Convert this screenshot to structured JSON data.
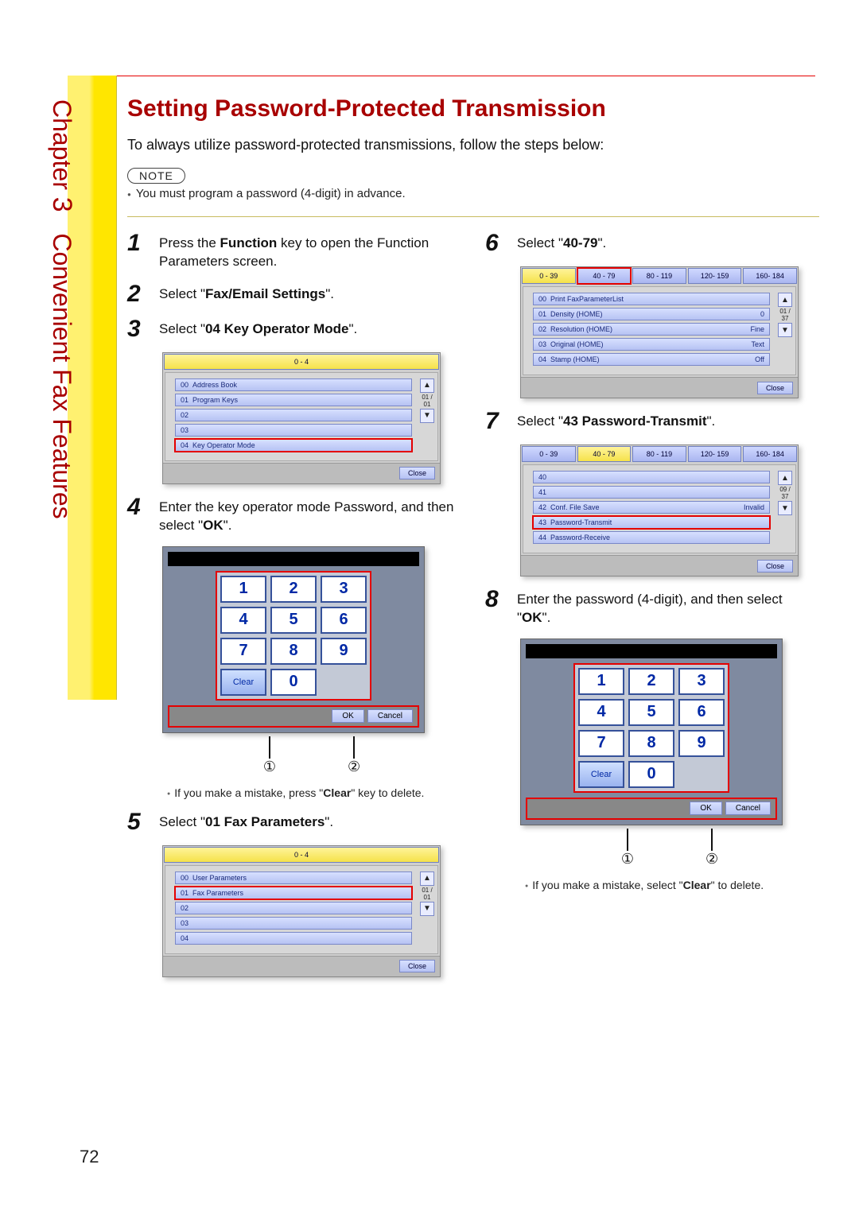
{
  "chapter": {
    "label": "Chapter",
    "number": "3",
    "subtitle": "Convenient Fax Features"
  },
  "page_number": "72",
  "title": "Setting Password-Protected Transmission",
  "intro": "To always utilize password-protected transmissions, follow the steps below:",
  "note": {
    "pill": "NOTE",
    "text": "You must program a password (4-digit) in advance."
  },
  "steps": {
    "s1": {
      "n": "1",
      "pre": "Press the ",
      "b": "Function",
      "post": " key to open the Function Parameters screen."
    },
    "s2": {
      "n": "2",
      "pre": "Select \"",
      "b": "Fax/Email Settings",
      "post": "\"."
    },
    "s3": {
      "n": "3",
      "pre": "Select \"",
      "b": "04 Key Operator Mode",
      "post": "\"."
    },
    "s4": {
      "n": "4",
      "pre": "Enter the key operator mode Password, and then select \"",
      "b": "OK",
      "post": "\"."
    },
    "s4_sub": {
      "pre": "If you make a mistake, press \"",
      "b": "Clear",
      "post": "\" key to delete."
    },
    "s5": {
      "n": "5",
      "pre": "Select \"",
      "b": "01 Fax Parameters",
      "post": "\"."
    },
    "s6": {
      "n": "6",
      "pre": "Select \"",
      "b": "40-79",
      "post": "\"."
    },
    "s7": {
      "n": "7",
      "pre": "Select \"",
      "b": "43 Password-Transmit",
      "post": "\"."
    },
    "s8": {
      "n": "8",
      "pre": "Enter the password (4-digit), and then select \"",
      "b": "OK",
      "post": "\"."
    },
    "s8_sub": {
      "pre": "If you make a mistake, select \"",
      "b": "Clear",
      "post": "\" to delete."
    }
  },
  "callout": {
    "c1": "①",
    "c2": "②"
  },
  "keypad": {
    "keys": [
      "1",
      "2",
      "3",
      "4",
      "5",
      "6",
      "7",
      "8",
      "9"
    ],
    "clear": "Clear",
    "zero": "0",
    "ok": "OK",
    "cancel": "Cancel"
  },
  "panel3": {
    "tab": "0 - 4",
    "rows": [
      {
        "id": "00",
        "label": "Address Book"
      },
      {
        "id": "01",
        "label": "Program Keys"
      },
      {
        "id": "02",
        "label": ""
      },
      {
        "id": "03",
        "label": ""
      },
      {
        "id": "04",
        "label": "Key Operator Mode"
      }
    ],
    "scroll": "01 / 01",
    "close": "Close"
  },
  "panel5": {
    "tab": "0 - 4",
    "rows": [
      {
        "id": "00",
        "label": "User Parameters"
      },
      {
        "id": "01",
        "label": "Fax Parameters"
      },
      {
        "id": "02",
        "label": ""
      },
      {
        "id": "03",
        "label": ""
      },
      {
        "id": "04",
        "label": ""
      }
    ],
    "scroll": "01 / 01",
    "close": "Close"
  },
  "panel6": {
    "tabs": [
      "0 - 39",
      "40 - 79",
      "80 - 119",
      "120- 159",
      "160- 184"
    ],
    "active_tab": 1,
    "rows": [
      {
        "id": "00",
        "label": "Print FaxParameterList",
        "val": ""
      },
      {
        "id": "01",
        "label": "Density (HOME)",
        "val": "0"
      },
      {
        "id": "02",
        "label": "Resolution (HOME)",
        "val": "Fine"
      },
      {
        "id": "03",
        "label": "Original (HOME)",
        "val": "Text"
      },
      {
        "id": "04",
        "label": "Stamp (HOME)",
        "val": "Off"
      }
    ],
    "scroll": "01 / 37",
    "close": "Close"
  },
  "panel7": {
    "tabs": [
      "0 - 39",
      "40 - 79",
      "80 - 119",
      "120- 159",
      "160- 184"
    ],
    "active_tab": 1,
    "rows": [
      {
        "id": "40",
        "label": "",
        "val": ""
      },
      {
        "id": "41",
        "label": "",
        "val": ""
      },
      {
        "id": "42",
        "label": "Conf. File Save",
        "val": "Invalid"
      },
      {
        "id": "43",
        "label": "Password-Transmit",
        "val": ""
      },
      {
        "id": "44",
        "label": "Password-Receive",
        "val": ""
      }
    ],
    "scroll": "09 / 37",
    "close": "Close"
  }
}
